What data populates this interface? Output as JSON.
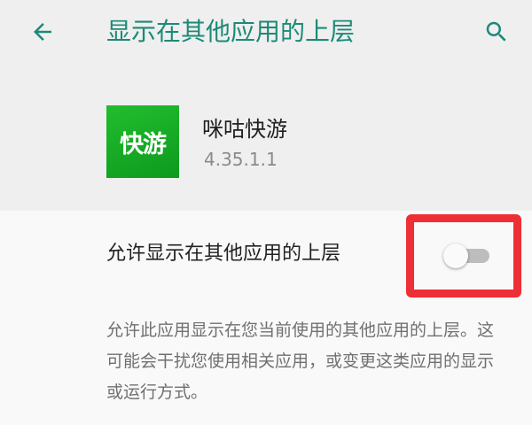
{
  "colors": {
    "accent": "#1c8a77",
    "app_icon": "#15ab25",
    "highlight": "#ee2f35",
    "switch_track_off": "#bdbdbd"
  },
  "toolbar": {
    "back_icon": "arrow-back-icon",
    "title": "显示在其他应用的上层",
    "search_icon": "search-icon"
  },
  "app": {
    "icon_text": "快游",
    "name": "咪咕快游",
    "version": "4.35.1.1"
  },
  "permission": {
    "label": "允许显示在其他应用的上层",
    "enabled": false,
    "description": "允许此应用显示在您当前使用的其他应用的上层。这可能会干扰您使用相关应用，或变更这类应用的显示或运行方式。"
  }
}
